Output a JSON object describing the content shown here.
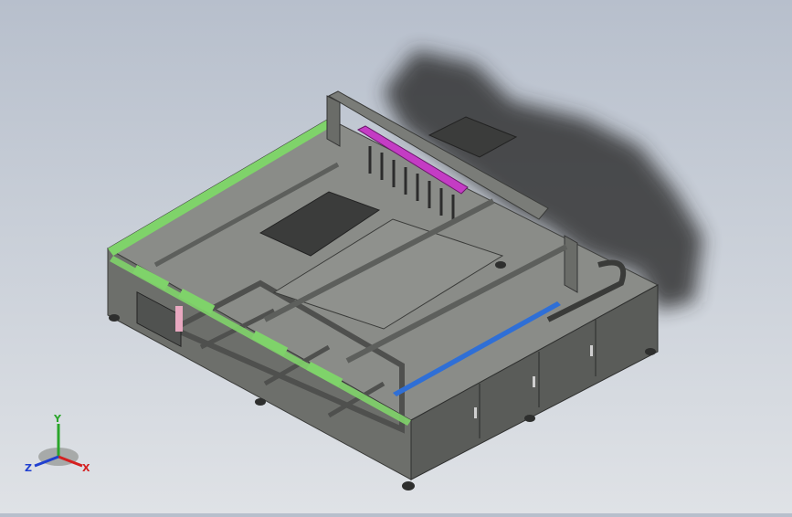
{
  "viewport": {
    "background_top": "#b7bfcc",
    "background_bottom": "#dfe2e6",
    "model_colors": {
      "frame": "#6f716c",
      "frame_dark": "#4a4c49",
      "panel": "#5d5f5c",
      "accent_green": "#7fd36a",
      "accent_magenta": "#c43cc4",
      "accent_blue": "#2f6fd6",
      "shadow": "#2c2c2c",
      "connector_pink": "#e8a8c0"
    }
  },
  "triad": {
    "x_label": "X",
    "y_label": "Y",
    "z_label": "Z",
    "x_color": "#d42020",
    "y_color": "#2aa52a",
    "z_color": "#2040d0"
  }
}
